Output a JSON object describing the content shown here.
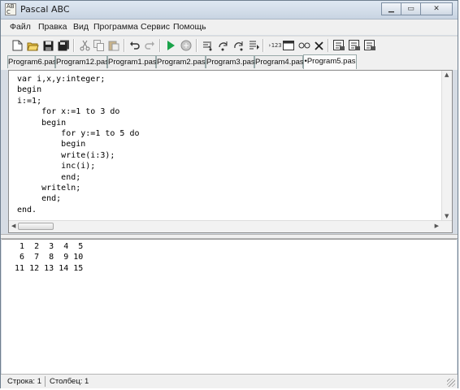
{
  "window": {
    "title": "Pascal ABC"
  },
  "menu": [
    "Файл",
    "Правка",
    "Вид",
    "Программа",
    "Сервис",
    "Помощь"
  ],
  "toolbar": {
    "buttons": [
      "new-file",
      "open",
      "save",
      "save-all",
      "cut",
      "copy",
      "paste",
      "undo",
      "redo",
      "run",
      "stop",
      "step-into",
      "step-over",
      "step-out",
      "run-to-cursor",
      "ascii-table",
      "window",
      "glasses",
      "close-x",
      "code-template-1",
      "code-template-2",
      "code-template-3"
    ],
    "hex_label": "›123"
  },
  "tabs": [
    {
      "label": "Program6.pas",
      "active": false
    },
    {
      "label": "Program12.pas",
      "active": false
    },
    {
      "label": "Program1.pas",
      "active": false
    },
    {
      "label": "Program2.pas",
      "active": false
    },
    {
      "label": "Program3.pas",
      "active": false
    },
    {
      "label": "Program4.pas",
      "active": false
    },
    {
      "label": "•Program5.pas",
      "active": true
    }
  ],
  "editor": {
    "code": "var i,x,y:integer;\nbegin\ni:=1;\n     for x:=1 to 3 do\n     begin\n         for y:=1 to 5 do\n         begin\n         write(i:3);\n         inc(i);\n         end;\n     writeln;\n     end;\nend."
  },
  "output": {
    "text": "  1  2  3  4  5\n  6  7  8  9 10\n 11 12 13 14 15"
  },
  "status": {
    "row": "Строка: 1",
    "col": "Столбец: 1"
  }
}
